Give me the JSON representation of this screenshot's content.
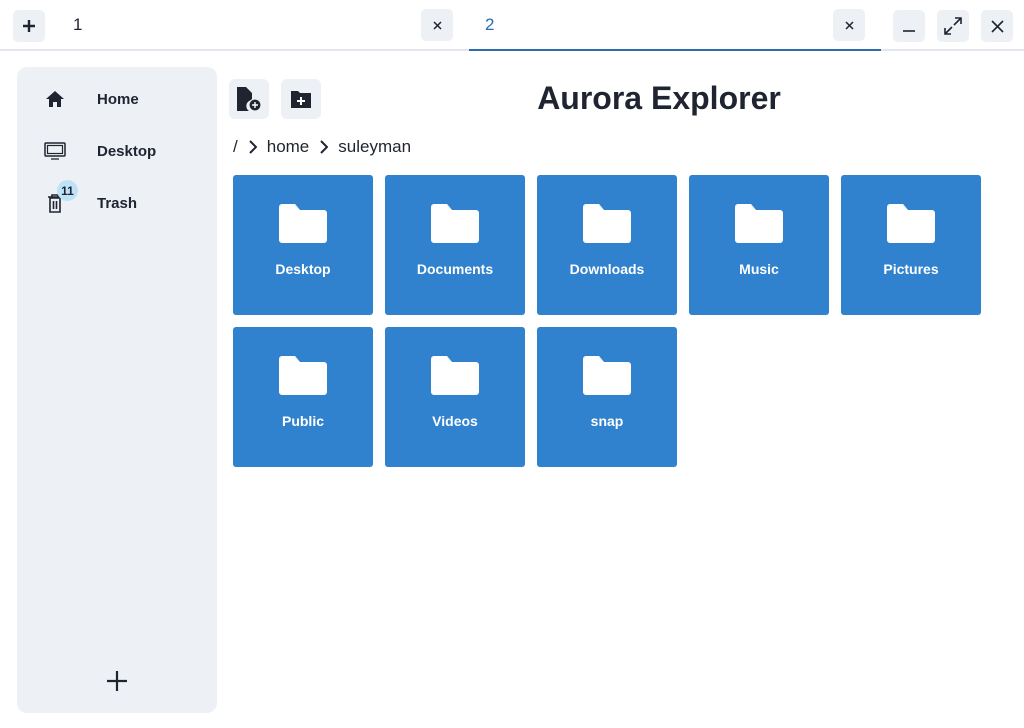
{
  "tabs": [
    {
      "label": "1",
      "active": false
    },
    {
      "label": "2",
      "active": true
    }
  ],
  "window": {
    "accent": "#2b6cb0"
  },
  "sidebar": {
    "items": [
      {
        "label": "Home",
        "icon": "home-icon"
      },
      {
        "label": "Desktop",
        "icon": "monitor-icon"
      },
      {
        "label": "Trash",
        "icon": "trash-icon",
        "badge": "11"
      }
    ]
  },
  "header": {
    "title": "Aurora Explorer"
  },
  "breadcrumb": [
    "/",
    "home",
    "suleyman"
  ],
  "folders": [
    "Desktop",
    "Documents",
    "Downloads",
    "Music",
    "Pictures",
    "Public",
    "Videos",
    "snap"
  ],
  "colors": {
    "folder_tile": "#3182ce",
    "sidebar_bg": "#edf1f5"
  }
}
